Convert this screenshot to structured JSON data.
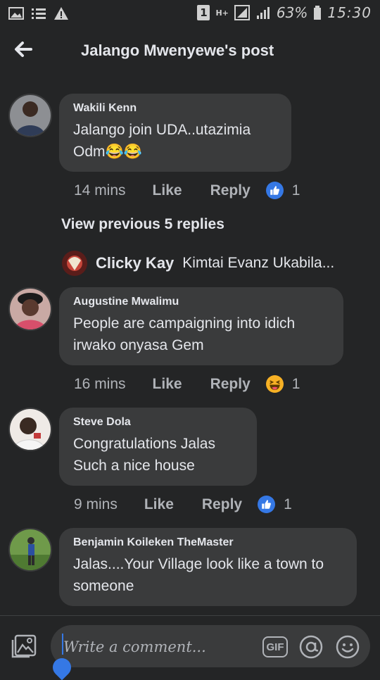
{
  "status_bar": {
    "sim": "1",
    "network": "H+",
    "battery": "63%",
    "time": "15:30"
  },
  "header": {
    "title": "Jalango Mwenyewe's post"
  },
  "comments": [
    {
      "author": "Wakili Kenn",
      "text": "Jalango join UDA..utazimia Odm",
      "emoji_suffix": "😂😂",
      "time": "14 mins",
      "like_label": "Like",
      "reply_label": "Reply",
      "reaction": "like",
      "reaction_count": "1"
    },
    {
      "author": "Augustine Mwalimu",
      "text": "People are campaigning into idich irwako onyasa Gem",
      "time": "16 mins",
      "like_label": "Like",
      "reply_label": "Reply",
      "reaction": "haha",
      "reaction_count": "1"
    },
    {
      "author": "Steve Dola",
      "text": "Congratulations Jalas Such a nice house",
      "time": "9 mins",
      "like_label": "Like",
      "reply_label": "Reply",
      "reaction": "like",
      "reaction_count": "1"
    },
    {
      "author": "Benjamin Koileken TheMaster",
      "text": "Jalas....Your Village look like a town to someone"
    }
  ],
  "replies_link": "View previous 5 replies",
  "reply_preview": {
    "author": "Clicky Kay",
    "text": "Kimtai Evanz Ukabila..."
  },
  "composer": {
    "placeholder": "Write a comment...",
    "gif_label": "GIF"
  },
  "colors": {
    "background": "#242526",
    "bubble": "#3a3b3c",
    "accent": "#3578e5",
    "haha": "#f7b125"
  }
}
